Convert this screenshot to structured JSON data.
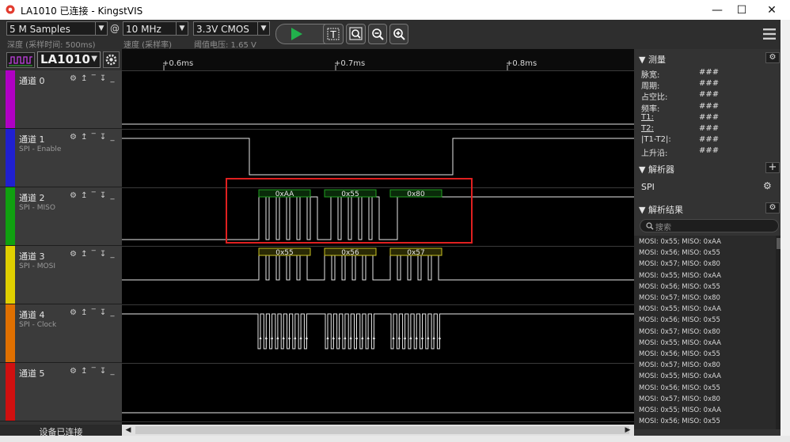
{
  "window": {
    "title": "LA1010 已连接 - KingstVIS",
    "minimize": "—",
    "maximize": "☐",
    "close": "✕"
  },
  "toolbar": {
    "depth_value": "5 M Samples",
    "depth_label": "深度 (采样时间: 500ms)",
    "at": "@",
    "rate_value": "10 MHz",
    "rate_label": "速度 (采样率)",
    "voltage_value": "3.3V CMOS",
    "voltage_label": "阈值电压: 1.65 V",
    "run_icon": "play-icon",
    "tool_icons": [
      "text-cursor-icon",
      "zoom-fit-icon",
      "zoom-out-icon",
      "zoom-in-icon"
    ],
    "menu_icon": "hamburger-menu-icon"
  },
  "device": {
    "name": "LA1010",
    "status": "设备已连接"
  },
  "channels": [
    {
      "index": "0",
      "name": "通道 0",
      "protocol": "",
      "color": "#b000c4"
    },
    {
      "index": "1",
      "name": "通道 1",
      "protocol": "SPI - Enable",
      "color": "#2020d0"
    },
    {
      "index": "2",
      "name": "通道 2",
      "protocol": "SPI - MISO",
      "color": "#10a010"
    },
    {
      "index": "3",
      "name": "通道 3",
      "protocol": "SPI - MOSI",
      "color": "#e0d000"
    },
    {
      "index": "4",
      "name": "通道 4",
      "protocol": "SPI - Clock",
      "color": "#e07000"
    },
    {
      "index": "5",
      "name": "通道 5",
      "protocol": "",
      "color": "#d01010"
    }
  ],
  "timeline": {
    "ticks": [
      "+0.6ms",
      "+0.7ms",
      "+0.8ms"
    ]
  },
  "decoded": {
    "miso": [
      "0xAA",
      "0x55",
      "0x80"
    ],
    "mosi": [
      "0x55",
      "0x56",
      "0x57"
    ]
  },
  "measure": {
    "title": "测量",
    "rows": [
      {
        "label": "脉宽:",
        "value": "###"
      },
      {
        "label": "周期:",
        "value": "###"
      },
      {
        "label": "占空比:",
        "value": "###"
      },
      {
        "label": "频率:",
        "value": "###"
      },
      {
        "label": "T1:",
        "value": "###"
      },
      {
        "label": "T2:",
        "value": "###"
      },
      {
        "label": "|T1-T2|:",
        "value": "###"
      },
      {
        "label": "上升沿:",
        "value": "###"
      }
    ]
  },
  "analyzers": {
    "title": "解析器",
    "add": "+",
    "items": [
      "SPI"
    ]
  },
  "results": {
    "title": "解析结果",
    "search_placeholder": "搜索",
    "rows": [
      "MOSI: 0x55;  MISO: 0xAA",
      "MOSI: 0x56;  MISO: 0x55",
      "MOSI: 0x57;  MISO: 0x80",
      "MOSI: 0x55;  MISO: 0xAA",
      "MOSI: 0x56;  MISO: 0x55",
      "MOSI: 0x57;  MISO: 0x80",
      "MOSI: 0x55;  MISO: 0xAA",
      "MOSI: 0x56;  MISO: 0x55",
      "MOSI: 0x57;  MISO: 0x80",
      "MOSI: 0x55;  MISO: 0xAA",
      "MOSI: 0x56;  MISO: 0x55",
      "MOSI: 0x57;  MISO: 0x80",
      "MOSI: 0x55;  MISO: 0xAA",
      "MOSI: 0x56;  MISO: 0x55",
      "MOSI: 0x57;  MISO: 0x80",
      "MOSI: 0x55;  MISO: 0xAA",
      "MOSI: 0x56;  MISO: 0x55"
    ]
  },
  "colors": {
    "highlight": "#e02020",
    "decode_miso": "#20a020",
    "decode_mosi": "#c8c020",
    "run_green": "#22b14c"
  }
}
